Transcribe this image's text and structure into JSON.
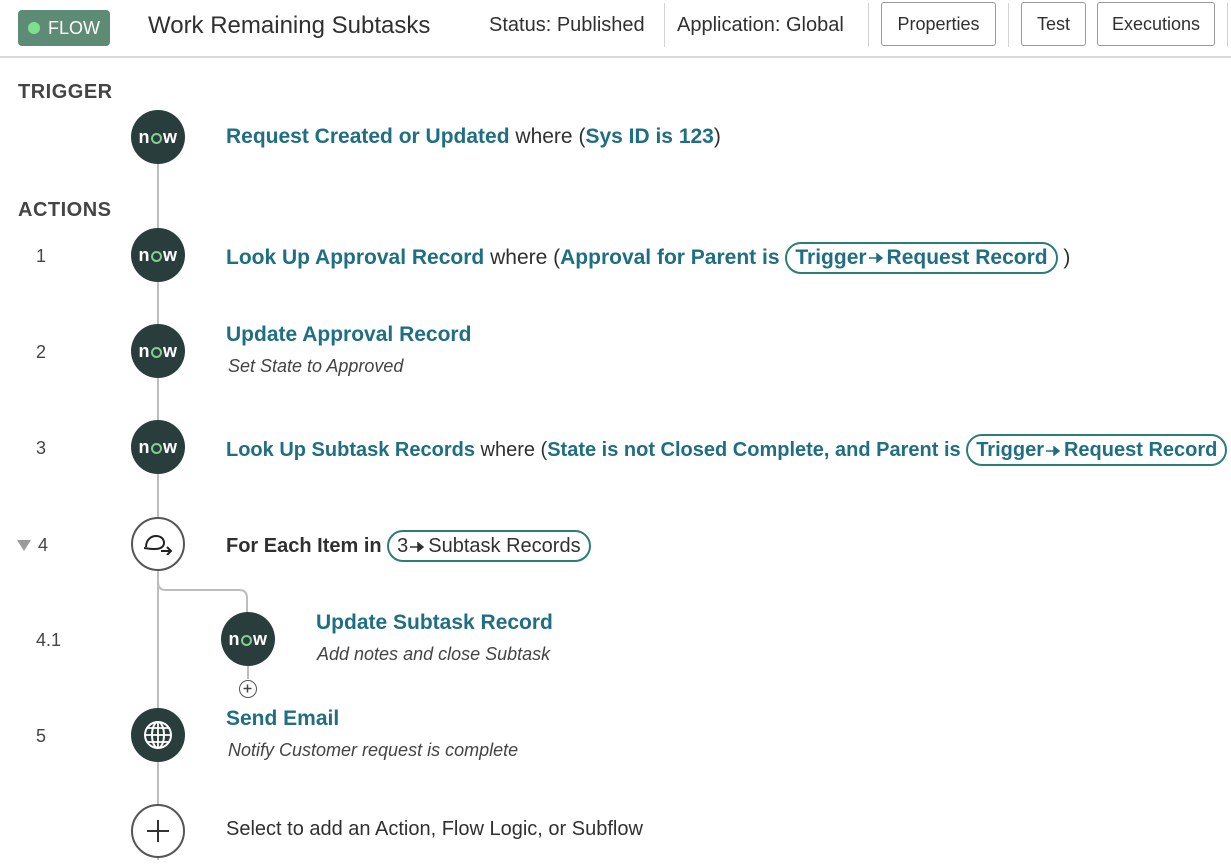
{
  "header": {
    "flow_badge": "FLOW",
    "title": "Work Remaining Subtasks",
    "status": "Status: Published",
    "application": "Application: Global",
    "buttons": {
      "properties": "Properties",
      "test": "Test",
      "executions": "Executions"
    }
  },
  "sections": {
    "trigger": "TRIGGER",
    "actions": "ACTIONS"
  },
  "trigger": {
    "name": "Request Created or Updated",
    "where": "where",
    "condition": "Sys ID is 123"
  },
  "steps": [
    {
      "num": "1",
      "name": "Look Up Approval Record",
      "where": "where",
      "condition": "Approval for Parent is",
      "pill_a": "Trigger",
      "pill_b": "Request Record"
    },
    {
      "num": "2",
      "name": "Update Approval Record",
      "sub": "Set State to Approved"
    },
    {
      "num": "3",
      "name": "Look Up Subtask Records",
      "where": "where",
      "condition": "State is not Closed Complete, and Parent is",
      "pill_a": "Trigger",
      "pill_b": "Request Record"
    },
    {
      "num": "4",
      "label": "For Each Item in",
      "pill_a": "3",
      "pill_b": "Subtask Records"
    },
    {
      "num": "4.1",
      "name": "Update Subtask Record",
      "sub": "Add notes and close Subtask"
    },
    {
      "num": "5",
      "name": "Send Email",
      "sub": "Notify Customer request is complete"
    }
  ],
  "add_prompt": "Select to add an Action, Flow Logic, or Subflow",
  "now_logo": {
    "n": "n",
    "w": "w"
  },
  "colors": {
    "badge": "#5e8b76",
    "node": "#2a3d3d",
    "link": "#1f6e83",
    "pill_border": "#2c7d73"
  }
}
